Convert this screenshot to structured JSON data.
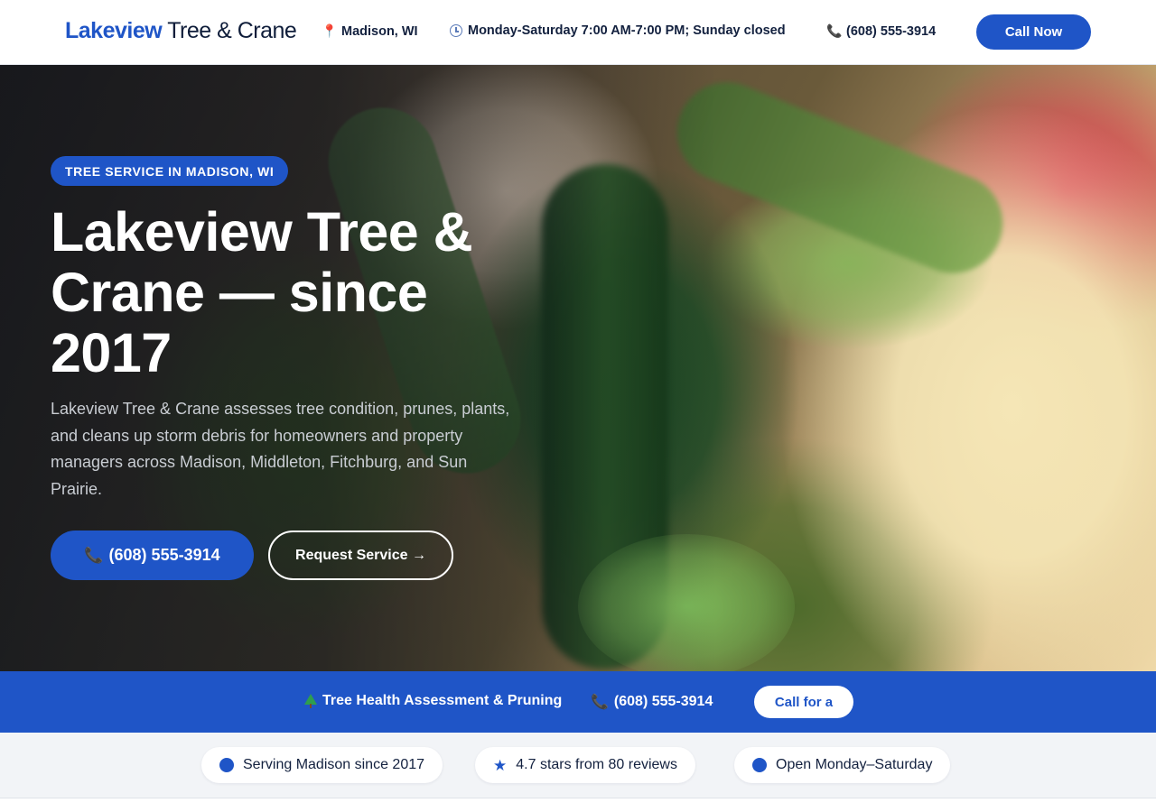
{
  "header": {
    "logo_part1": "Lakeview",
    "logo_part2": "Tree & Crane",
    "location": "Madison, WI",
    "hours": "Monday-Saturday 7:00 AM-7:00 PM; Sunday closed",
    "phone": "(608) 555-3914",
    "cta_label": "Call Now"
  },
  "hero": {
    "badge": "TREE SERVICE IN MADISON, WI",
    "title": "Lakeview Tree & Crane — since 2017",
    "lead": "Lakeview Tree & Crane assesses tree condition, prunes, plants, and cleans up storm debris for homeowners and property managers across Madison, Middleton, Fitchburg, and Sun Prairie.",
    "phone_button": "(608) 555-3914",
    "request_button": "Request Service →"
  },
  "strip": {
    "service": "Tree Health Assessment & Pruning",
    "phone": "(608) 555-3914",
    "cta_label": "Call for a"
  },
  "trust": {
    "items": [
      {
        "label": "Serving Madison since 2017",
        "icon": "dot-icon"
      },
      {
        "label": "4.7 stars from 80 reviews",
        "icon": "star-icon"
      },
      {
        "label": "Open Monday–Saturday",
        "icon": "dot-icon"
      }
    ]
  },
  "colors": {
    "brand_blue": "#1f55c7",
    "navy_text": "#0f1d3a",
    "trust_bg": "#f2f4f7"
  }
}
